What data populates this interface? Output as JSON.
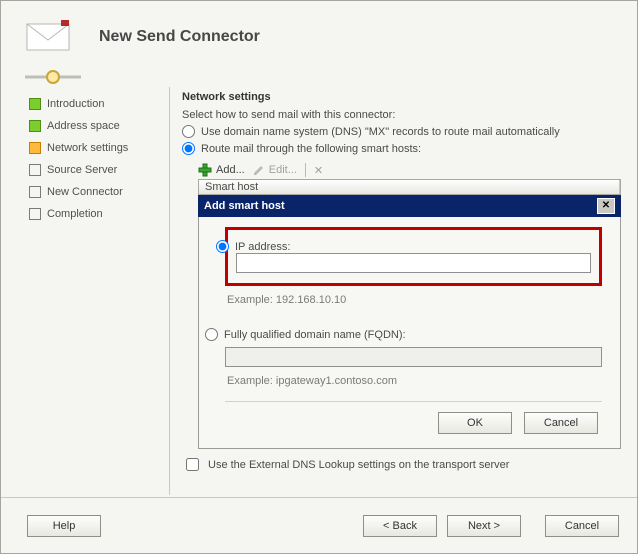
{
  "header": {
    "title": "New Send Connector"
  },
  "sidebar": {
    "steps": [
      {
        "label": "Introduction",
        "state": "done"
      },
      {
        "label": "Address space",
        "state": "done"
      },
      {
        "label": "Network settings",
        "state": "current"
      },
      {
        "label": "Source Server",
        "state": "pending"
      },
      {
        "label": "New Connector",
        "state": "pending"
      },
      {
        "label": "Completion",
        "state": "pending"
      }
    ]
  },
  "main": {
    "section_title": "Network settings",
    "instruction": "Select how to send mail with this connector:",
    "option_dns": "Use domain name system (DNS) \"MX\" records to route mail automatically",
    "option_smart": "Route mail through the following smart hosts:",
    "selected_option": "smart",
    "toolbar": {
      "add": "Add...",
      "edit": "Edit...",
      "remove": "✕"
    },
    "column_header": "Smart host",
    "ext_dns_checkbox": "Use the External DNS Lookup settings on the transport server",
    "ext_dns_checked": false
  },
  "dialog": {
    "title": "Add smart host",
    "option_ip": "IP address:",
    "option_fqdn": "Fully qualified domain name (FQDN):",
    "selected": "ip",
    "ip_value": "",
    "ip_example": "Example: 192.168.10.10",
    "fqdn_value": "",
    "fqdn_example": "Example: ipgateway1.contoso.com",
    "ok": "OK",
    "cancel": "Cancel"
  },
  "footer": {
    "help": "Help",
    "back": "< Back",
    "next": "Next >",
    "cancel": "Cancel"
  }
}
